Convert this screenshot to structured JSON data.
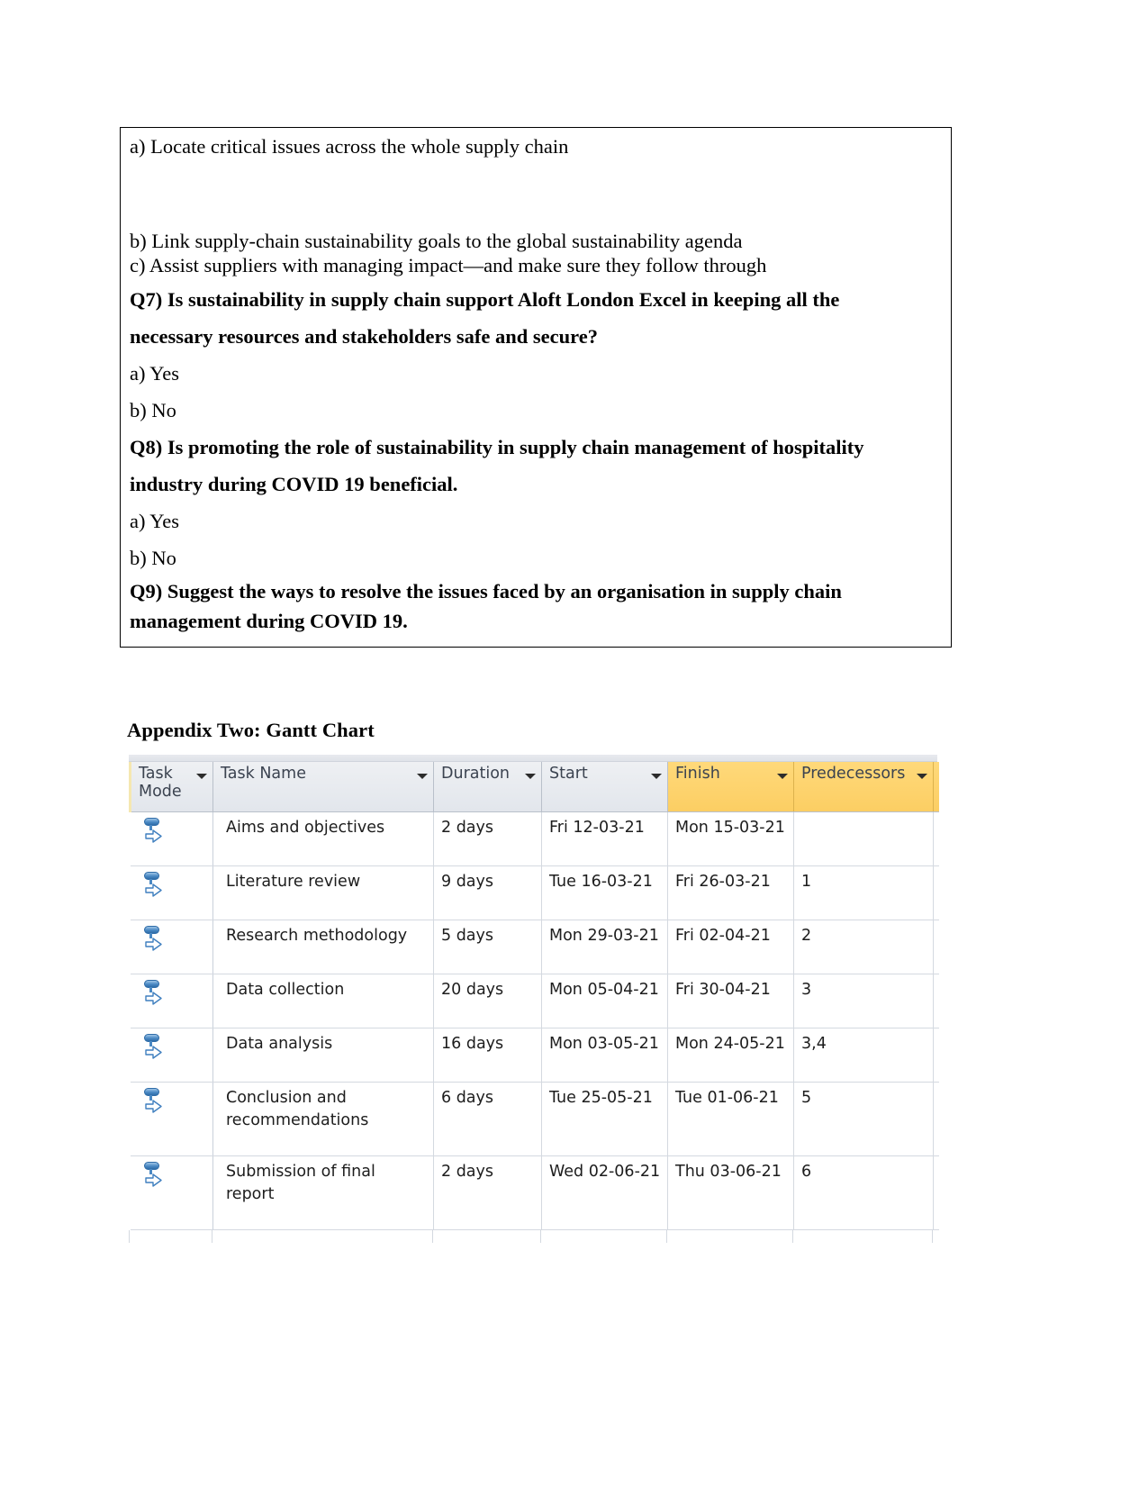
{
  "question_box": {
    "options_pre": [
      "a) Locate critical issues across the whole supply chain",
      "b) Link supply-chain sustainability goals to the global sustainability agenda",
      " c) Assist suppliers with managing impact—and make sure they follow through"
    ],
    "q7": {
      "text": "Q7) Is sustainability in supply chain support Aloft London Excel in keeping all the",
      "text_last": "necessary resources and stakeholders safe and secure?",
      "options": [
        "a) Yes",
        "b) No"
      ]
    },
    "q8": {
      "text": "Q8) Is promoting the role of sustainability in supply chain management of hospitality",
      "text_last": "industry during COVID 19 beneficial.",
      "options": [
        "a) Yes",
        "b) No"
      ]
    },
    "q9": {
      "text": "Q9) Suggest the ways to resolve the issues faced by an organisation in supply chain",
      "text_last": "management during COVID 19."
    }
  },
  "appendix": {
    "title": "Appendix Two: Gantt Chart"
  },
  "gantt": {
    "columns": [
      {
        "label": "Task\nMode",
        "highlight": false,
        "icon": "chevron-down-icon"
      },
      {
        "label": "Task Name",
        "highlight": false,
        "icon": "chevron-down-icon"
      },
      {
        "label": "Duration",
        "highlight": false,
        "icon": "chevron-down-icon"
      },
      {
        "label": "Start",
        "highlight": false,
        "icon": "chevron-down-icon"
      },
      {
        "label": "Finish",
        "highlight": true,
        "icon": "chevron-down-icon"
      },
      {
        "label": "Predecessors",
        "highlight": true,
        "icon": "chevron-down-icon"
      }
    ],
    "header_highlight_color": "#FCCE63",
    "rows": [
      {
        "mode_icon": "manually-scheduled-icon",
        "name": "Aims and objectives",
        "duration": "2 days",
        "start": "Fri 12-03-21",
        "finish": "Mon 15-03-21",
        "predecessors": ""
      },
      {
        "mode_icon": "manually-scheduled-icon",
        "name": "Literature review",
        "duration": "9 days",
        "start": "Tue 16-03-21",
        "finish": "Fri 26-03-21",
        "predecessors": "1"
      },
      {
        "mode_icon": "manually-scheduled-icon",
        "name": "Research methodology",
        "duration": "5 days",
        "start": "Mon 29-03-21",
        "finish": "Fri 02-04-21",
        "predecessors": "2"
      },
      {
        "mode_icon": "manually-scheduled-icon",
        "name": "Data collection",
        "duration": "20 days",
        "start": "Mon 05-04-21",
        "finish": "Fri 30-04-21",
        "predecessors": "3"
      },
      {
        "mode_icon": "manually-scheduled-icon",
        "name": "Data analysis",
        "duration": "16 days",
        "start": "Mon 03-05-21",
        "finish": "Mon 24-05-21",
        "predecessors": "3,4"
      },
      {
        "mode_icon": "manually-scheduled-icon",
        "name": "Conclusion and recommendations",
        "duration": "6 days",
        "start": "Tue 25-05-21",
        "finish": "Tue 01-06-21",
        "predecessors": "5"
      },
      {
        "mode_icon": "manually-scheduled-icon",
        "name": "Submission of final report",
        "duration": "2 days",
        "start": "Wed 02-06-21",
        "finish": "Thu 03-06-21",
        "predecessors": "6"
      }
    ]
  }
}
